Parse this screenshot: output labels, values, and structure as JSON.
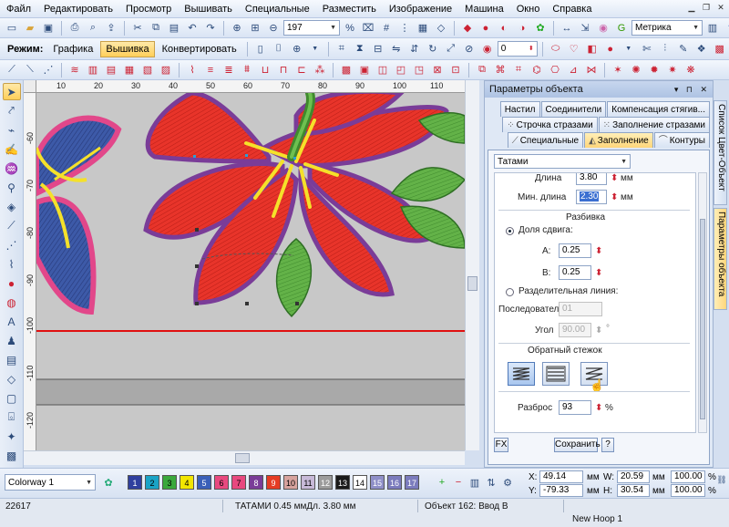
{
  "menu": [
    "Файл",
    "Редактировать",
    "Просмотр",
    "Вышивать",
    "Специальные",
    "Разместить",
    "Изображение",
    "Машина",
    "Окно",
    "Справка"
  ],
  "toolbar1": {
    "stitch_count_value": "197",
    "units_value": "Метрика"
  },
  "toolbar2": {
    "mode_label": "Режим:",
    "mode_graphics": "Графика",
    "mode_embroidery": "Вышивка",
    "mode_convert": "Конвертировать",
    "angle_value": "0"
  },
  "ruler": {
    "h_ticks": [
      "10",
      "20",
      "30",
      "40",
      "50",
      "60",
      "70",
      "80",
      "90",
      "100",
      "110"
    ],
    "v_ticks": [
      "-60",
      "-70",
      "-80",
      "-90",
      "-100",
      "-110",
      "-120"
    ]
  },
  "panel": {
    "title": "Параметры объекта",
    "tabs_row1": [
      "Настил",
      "Соединители",
      "Компенсация стягив..."
    ],
    "tabs_row2": [
      "Строчка стразами",
      "Заполнение стразами"
    ],
    "tabs_row3": [
      "Специальные",
      "Заполнение",
      "Контуры"
    ],
    "fill_type": "Татами",
    "length_label": "Длина",
    "length_value": "3.80",
    "min_length_label": "Мин. длина",
    "min_length_value": "2.30",
    "unit_mm": "мм",
    "partition_heading": "Разбивка",
    "shift_fraction_label": "Доля сдвига:",
    "a_label": "A:",
    "a_value": "0.25",
    "b_label": "B:",
    "b_value": "0.25",
    "divider_line_label": "Разделительная линия:",
    "sequence_label": "Последовател",
    "sequence_value": "01",
    "angle_label": "Угол",
    "angle_value": "90.00",
    "degree_sign": "°",
    "back_stitch_heading": "Обратный стежок",
    "scatter_label": "Разброс",
    "scatter_value": "93",
    "percent": "%",
    "fx_button": "FX",
    "save_button": "Сохранить",
    "help_button": "?"
  },
  "side_tabs": [
    "Список Цвет-Объект",
    "Параметры объекта"
  ],
  "bottom": {
    "colorway": "Colorway 1",
    "swatches": [
      {
        "n": "1",
        "color": "#2f3f9e"
      },
      {
        "n": "2",
        "color": "#1aa3c6"
      },
      {
        "n": "3",
        "color": "#3aa83c"
      },
      {
        "n": "4",
        "color": "#f2e600"
      },
      {
        "n": "5",
        "color": "#3a5fb8"
      },
      {
        "n": "6",
        "color": "#e8497f"
      },
      {
        "n": "7",
        "color": "#e8497f"
      },
      {
        "n": "8",
        "color": "#7a3c98"
      },
      {
        "n": "9",
        "color": "#e53c24"
      },
      {
        "n": "10",
        "color": "#d7a39e"
      },
      {
        "n": "11",
        "color": "#c7b9d8"
      },
      {
        "n": "12",
        "color": "#9c9c9c"
      },
      {
        "n": "13",
        "color": "#1a1a1a"
      },
      {
        "n": "14",
        "color": "#ffffff"
      },
      {
        "n": "15",
        "color": "#8f8fc8"
      },
      {
        "n": "16",
        "color": "#7b7bbd"
      },
      {
        "n": "17",
        "color": "#7b7bbd"
      }
    ],
    "x_label": "X:",
    "x_value": "49.14",
    "y_label": "Y:",
    "y_value": "-79.33",
    "w_label": "W:",
    "w_value": "20.59",
    "h_label": "H:",
    "h_value": "30.54",
    "unit_mm": "мм",
    "scale_w": "100.00",
    "scale_h": "100.00",
    "percent": "%"
  },
  "status": {
    "stitch_count": "22617",
    "object_info": "ТАТАМИ 0.45 ммДл. 3.80 мм",
    "object_ref": "Объект 162: Ввод В",
    "hoop": "New Hoop 1"
  }
}
